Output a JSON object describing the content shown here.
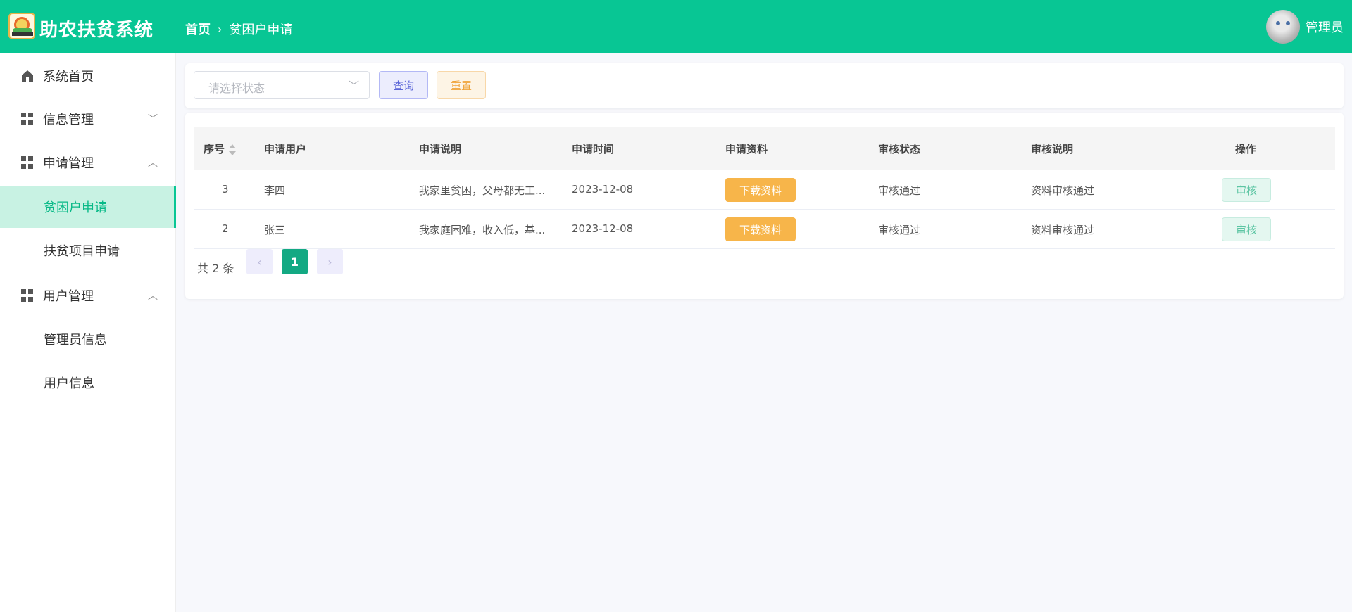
{
  "header": {
    "app_title": "助农扶贫系统",
    "breadcrumb": [
      "首页",
      "贫困户申请"
    ],
    "user_name": "管理员"
  },
  "sidebar": {
    "items": [
      {
        "label": "系统首页",
        "icon": "home-icon"
      },
      {
        "label": "信息管理",
        "icon": "grid-icon",
        "expanded": false
      },
      {
        "label": "申请管理",
        "icon": "grid-icon",
        "expanded": true
      },
      {
        "label": "贫困户申请",
        "active": true
      },
      {
        "label": "扶贫项目申请"
      },
      {
        "label": "用户管理",
        "icon": "grid-icon",
        "expanded": true
      },
      {
        "label": "管理员信息"
      },
      {
        "label": "用户信息"
      }
    ]
  },
  "filter": {
    "status_placeholder": "请选择状态",
    "query_label": "查询",
    "reset_label": "重置"
  },
  "table": {
    "columns": [
      "序号",
      "申请用户",
      "申请说明",
      "申请时间",
      "申请资料",
      "审核状态",
      "审核说明",
      "操作"
    ],
    "rows": [
      {
        "id": "3",
        "user": "李四",
        "desc": "我家里贫困，父母都无工...",
        "time": "2023-12-08",
        "file_btn": "下载资料",
        "status": "审核通过",
        "note": "资料审核通过",
        "action": "审核"
      },
      {
        "id": "2",
        "user": "张三",
        "desc": "我家庭困难，收入低，基...",
        "time": "2023-12-08",
        "file_btn": "下载资料",
        "status": "审核通过",
        "note": "资料审核通过",
        "action": "审核"
      }
    ]
  },
  "pagination": {
    "total_text": "共 2 条",
    "current_page": "1",
    "prev": "‹",
    "next": "›"
  },
  "colors": {
    "primary": "#08c694",
    "download": "#f7b54a",
    "active_bg": "#c8f2e3"
  }
}
